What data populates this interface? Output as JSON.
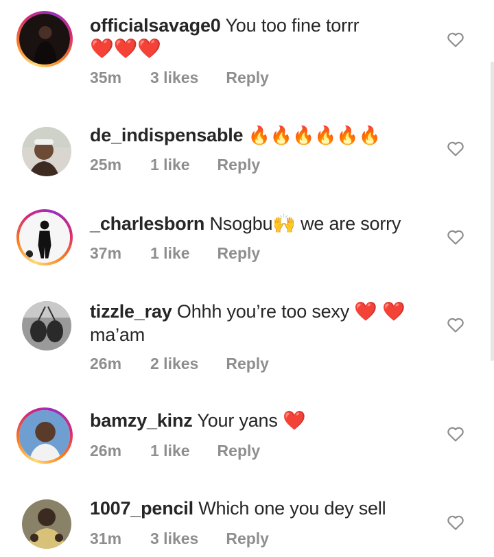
{
  "comments": [
    {
      "username": "officialsavage0",
      "text": "You too fine torrr",
      "emojis": "❤️❤️❤️",
      "time": "35m",
      "likes": "3 likes",
      "reply": "Reply",
      "story_ring": true
    },
    {
      "username": "de_indispensable",
      "text": "",
      "emojis": "🔥🔥🔥🔥🔥🔥",
      "time": "25m",
      "likes": "1 like",
      "reply": "Reply",
      "story_ring": false
    },
    {
      "username": "_charlesborn",
      "text": "Nsogbu🙌 we are sorry",
      "emojis": "",
      "time": "37m",
      "likes": "1 like",
      "reply": "Reply",
      "story_ring": true
    },
    {
      "username": "tizzle_ray",
      "text": "Ohhh you’re too sexy ❤️ ❤️ ma’am",
      "emojis": "",
      "time": "26m",
      "likes": "2 likes",
      "reply": "Reply",
      "story_ring": false
    },
    {
      "username": "bamzy_kinz",
      "text": "Your yans ❤️",
      "emojis": "",
      "time": "26m",
      "likes": "1 like",
      "reply": "Reply",
      "story_ring": true
    },
    {
      "username": "1007_pencil",
      "text": "Which one you dey sell",
      "emojis": "",
      "time": "31m",
      "likes": "3 likes",
      "reply": "Reply",
      "story_ring": false
    }
  ],
  "icons": {
    "like": "heart-outline-icon"
  },
  "colors": {
    "meta": "#8e8e8e",
    "text": "#262626",
    "story_ring": "#d62976"
  }
}
